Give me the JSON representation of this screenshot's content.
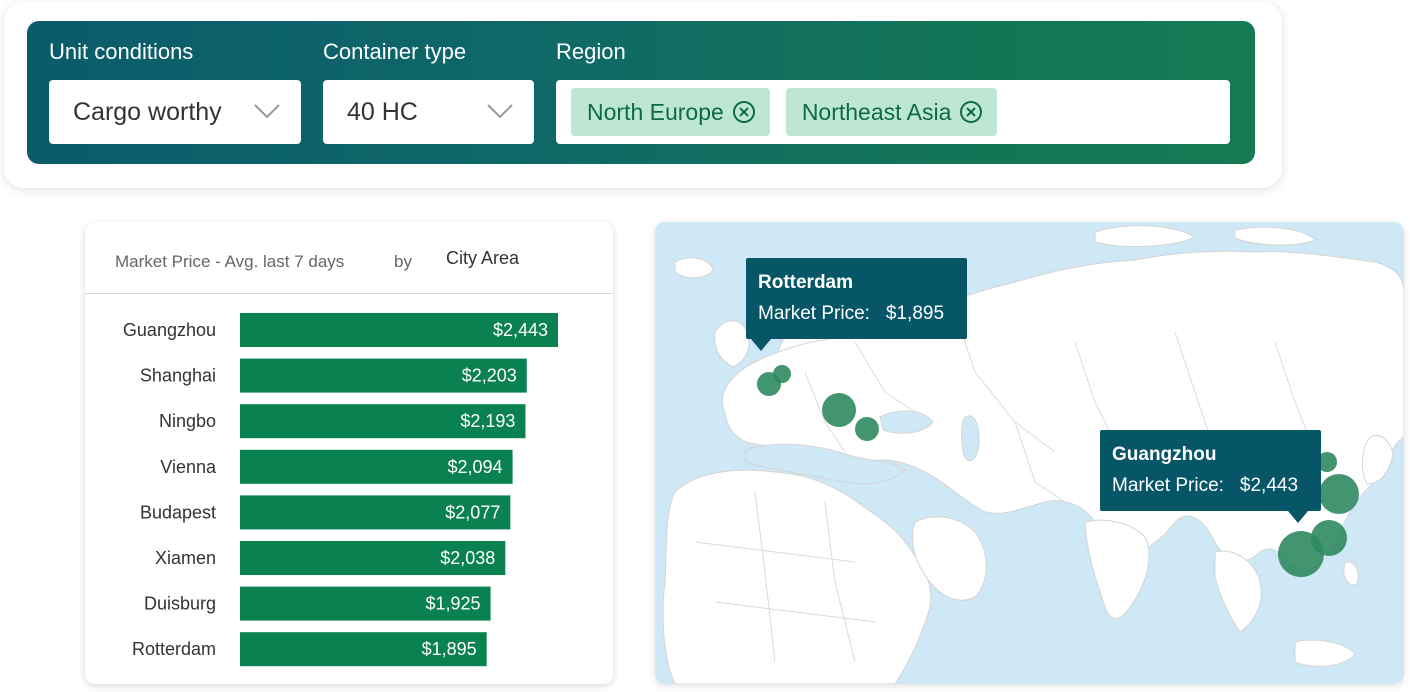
{
  "filters": {
    "unit_conditions": {
      "label": "Unit conditions",
      "value": "Cargo worthy"
    },
    "container_type": {
      "label": "Container type",
      "value": "40 HC"
    },
    "region": {
      "label": "Region",
      "chips": [
        "North Europe",
        "Northeast Asia"
      ]
    }
  },
  "chart": {
    "title": "Market Price - Avg. last 7 days",
    "by": "by",
    "dimension": "City Area"
  },
  "chart_data": {
    "type": "bar",
    "orientation": "horizontal",
    "title": "Market Price - Avg. last 7 days",
    "categories": [
      "Guangzhou",
      "Shanghai",
      "Ningbo",
      "Vienna",
      "Budapest",
      "Xiamen",
      "Duisburg",
      "Rotterdam"
    ],
    "values": [
      2443,
      2203,
      2193,
      2094,
      2077,
      2038,
      1925,
      1895
    ],
    "value_labels": [
      "$2,443",
      "$2,203",
      "$2,193",
      "$2,094",
      "$2,077",
      "$2,038",
      "$1,925",
      "$1,895"
    ],
    "xlim": [
      0,
      3000
    ],
    "color": "#0a8150"
  },
  "map": {
    "tooltips": [
      {
        "city": "Rotterdam",
        "label": "Market Price:",
        "value": "$1,895"
      },
      {
        "city": "Guangzhou",
        "label": "Market Price:",
        "value": "$2,443"
      }
    ],
    "colors": {
      "water": "#cfe8f5",
      "land": "#ffffff",
      "bubble": "#2e8a5f",
      "tooltip": "#075668"
    }
  }
}
